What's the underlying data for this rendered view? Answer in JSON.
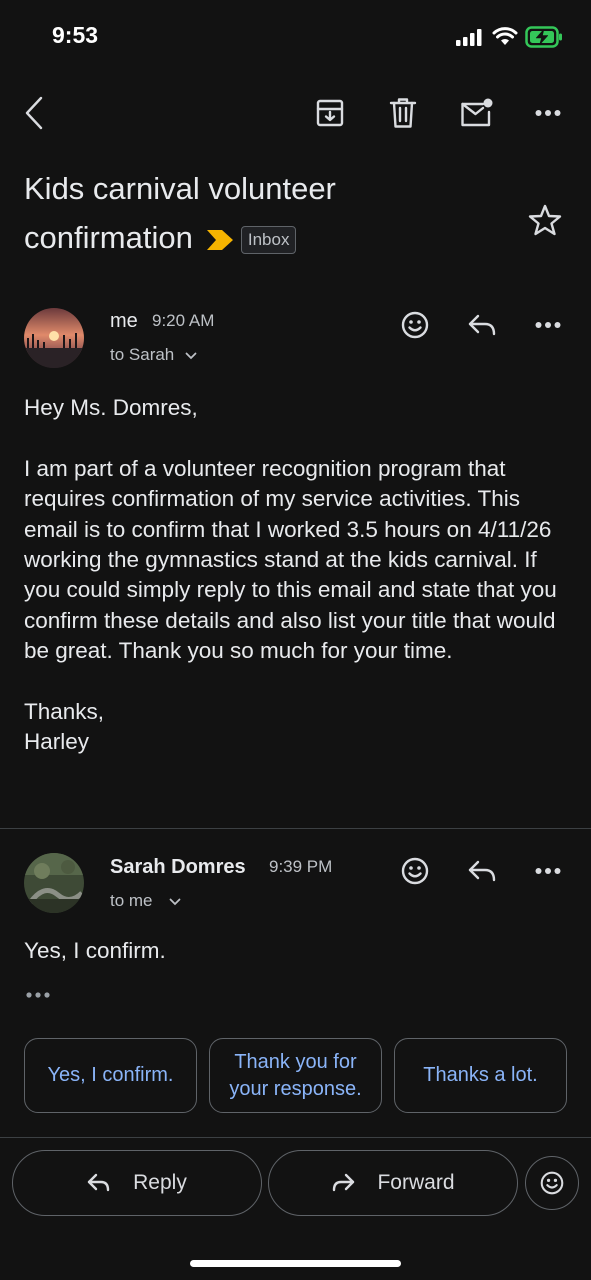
{
  "status_bar": {
    "time": "9:53"
  },
  "email": {
    "subject": "Kids carnival volunteer confirmation",
    "label": "Inbox",
    "messages": [
      {
        "sender": "me",
        "time": "9:20 AM",
        "recipient": "to Sarah",
        "body": "Hey Ms. Domres,\n\nI am part of a volunteer recognition program that requires confirmation of my service activities. This email is to confirm that I worked 3.5 hours on 4/11/26 working the gymnastics stand at the kids carnival. If you could simply reply to this email and state that you confirm these details and also list your title that would be great. Thank you so much for your time.\n\nThanks,\nHarley"
      },
      {
        "sender": "Sarah Domres",
        "time": "9:39 PM",
        "recipient": "to me",
        "body": "Yes, I confirm."
      }
    ]
  },
  "smart_replies": [
    "Yes, I confirm.",
    "Thank you for your response.",
    "Thanks a lot."
  ],
  "actions": {
    "reply": "Reply",
    "forward": "Forward"
  },
  "colors": {
    "background": "#121212",
    "link": "#8ab4f8",
    "important": "#f6b400",
    "battery": "#34c759"
  }
}
